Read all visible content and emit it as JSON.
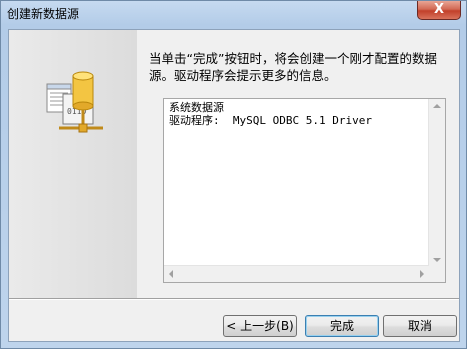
{
  "window": {
    "title": "创建新数据源",
    "close_label": "X"
  },
  "message": "当单击“完成”按钮时，将会创建一个刚才配置的数据源。驱动程序会提示更多的信息。",
  "listbox": {
    "lines": [
      "系统数据源",
      "驱动程序:  MySQL ODBC 5.1 Driver"
    ]
  },
  "illustration": {
    "code_text": "0110"
  },
  "buttons": {
    "back": "< 上一步(B)",
    "finish": "完成",
    "cancel": "取消"
  }
}
